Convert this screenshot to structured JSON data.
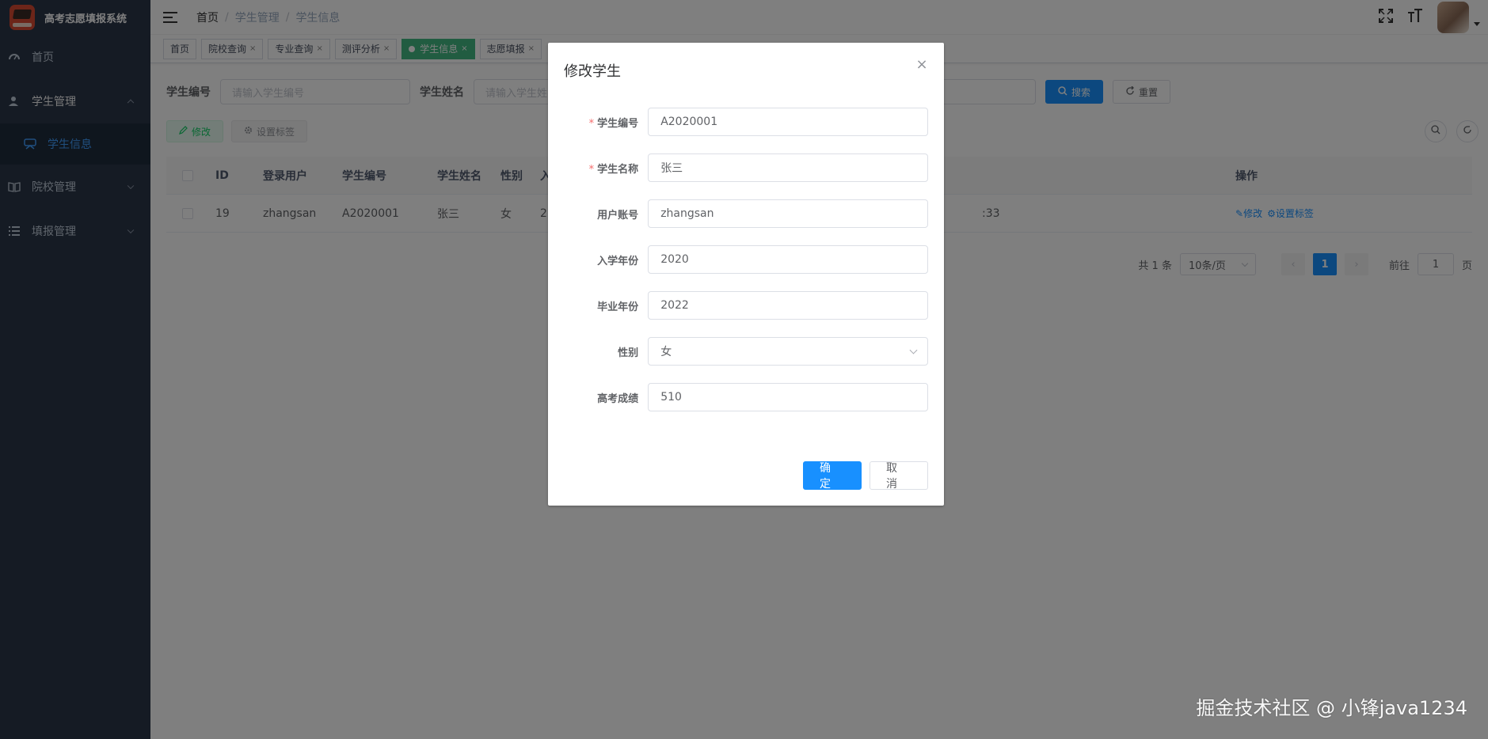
{
  "sidebar": {
    "title": "高考志愿填报系统",
    "items": [
      {
        "label": "首页"
      },
      {
        "label": "学生管理"
      },
      {
        "label": "学生信息"
      },
      {
        "label": "院校管理"
      },
      {
        "label": "填报管理"
      }
    ]
  },
  "breadcrumb": [
    "首页",
    "学生管理",
    "学生信息"
  ],
  "tags": [
    {
      "label": "首页"
    },
    {
      "label": "院校查询"
    },
    {
      "label": "专业查询"
    },
    {
      "label": "测评分析"
    },
    {
      "label": "学生信息"
    },
    {
      "label": "志愿填报"
    }
  ],
  "search": {
    "student_no_label": "学生编号",
    "student_no_placeholder": "请输入学生编号",
    "student_name_label": "学生姓名",
    "student_name_placeholder": "请输入学生姓名",
    "search_btn": "搜索",
    "reset_btn": "重置"
  },
  "toolbar": {
    "edit_btn": "修改",
    "tag_btn": "设置标签"
  },
  "table": {
    "headers": [
      "ID",
      "登录用户",
      "学生编号",
      "学生姓名",
      "性别",
      "入",
      "操作"
    ],
    "rows": [
      {
        "id": "19",
        "user": "zhangsan",
        "no": "A2020001",
        "name": "张三",
        "gender": "女",
        "year": "2",
        "time": ":33",
        "edit": "修改",
        "tag": "设置标签"
      }
    ]
  },
  "pager": {
    "total": "共 1 条",
    "page_size": "10条/页",
    "current": "1",
    "goto_label": "前往",
    "goto_value": "1",
    "page_suffix": "页"
  },
  "dialog": {
    "title": "修改学生",
    "fields": [
      {
        "label": "学生编号",
        "value": "A2020001"
      },
      {
        "label": "学生名称",
        "value": "张三"
      },
      {
        "label": "用户账号",
        "value": "zhangsan"
      },
      {
        "label": "入学年份",
        "value": "2020"
      },
      {
        "label": "毕业年份",
        "value": "2022"
      },
      {
        "label": "性别",
        "value": "女"
      },
      {
        "label": "高考成绩",
        "value": "510"
      }
    ],
    "confirm": "确 定",
    "cancel": "取 消"
  },
  "watermark": "掘金技术社区 @ 小锋java1234",
  "colors": {
    "sidebar_bg": "#2b3648",
    "primary": "#1890ff",
    "active_tag": "#42b983"
  }
}
